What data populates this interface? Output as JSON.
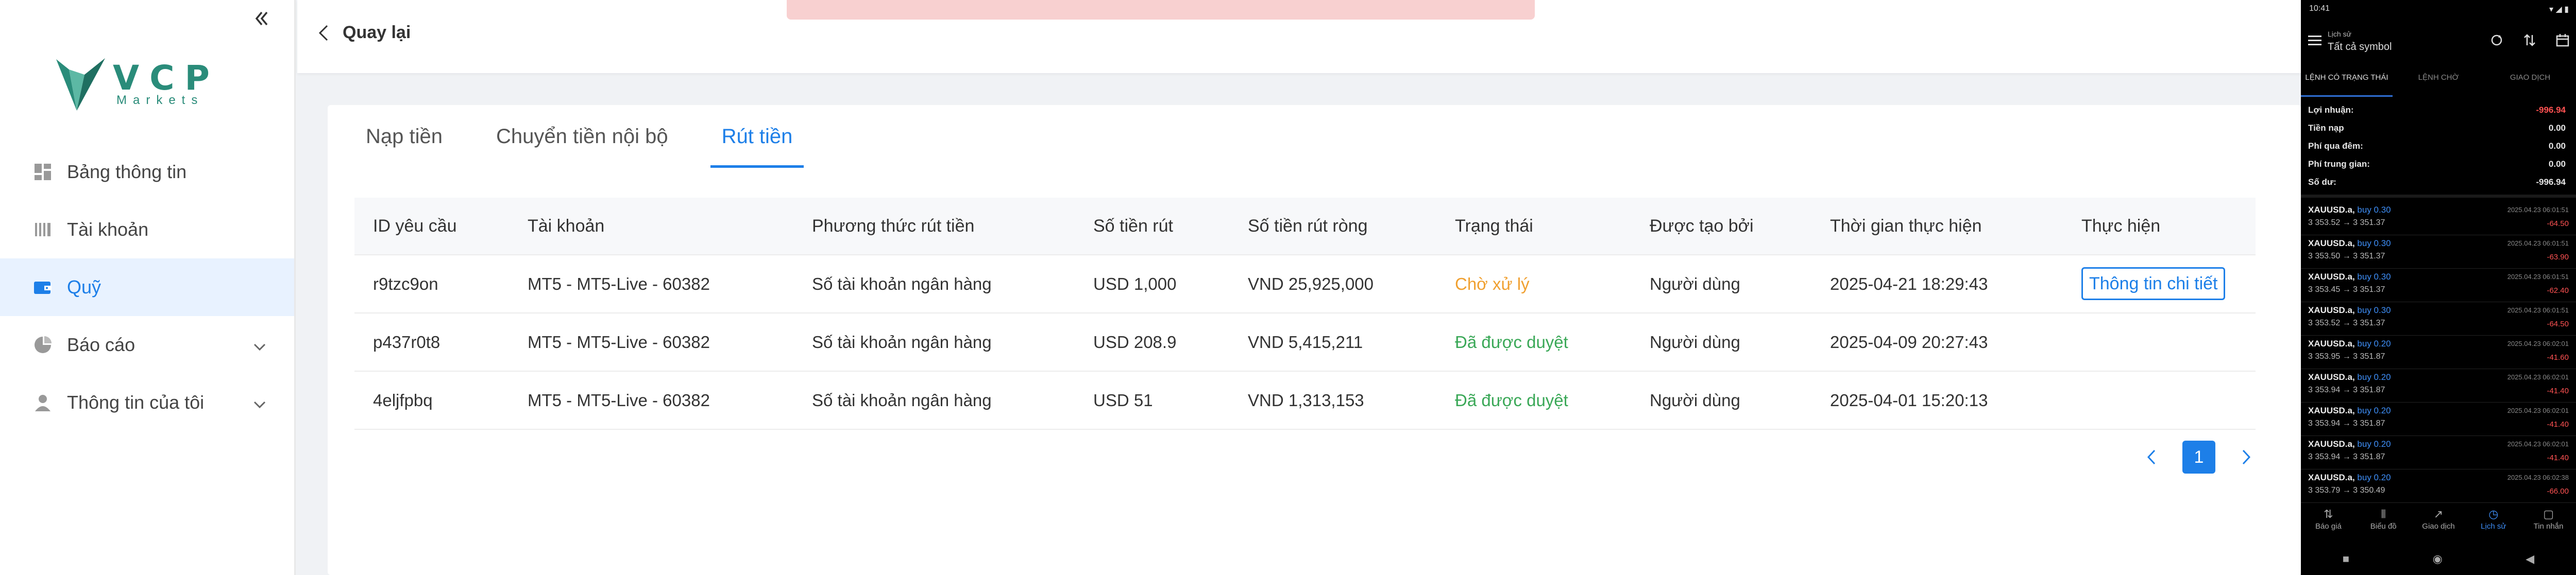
{
  "sidebar": {
    "logo_text": "VCP",
    "logo_sub": "Markets",
    "items": [
      {
        "label": "Bảng thông tin"
      },
      {
        "label": "Tài khoản"
      },
      {
        "label": "Quỹ"
      },
      {
        "label": "Báo cáo"
      },
      {
        "label": "Thông tin của tôi"
      }
    ]
  },
  "header": {
    "back_label": "Quay lại"
  },
  "tabs": [
    {
      "label": "Nạp tiền"
    },
    {
      "label": "Chuyển tiền nội bộ"
    },
    {
      "label": "Rút tiền"
    }
  ],
  "table": {
    "columns": [
      "ID yêu cầu",
      "Tài khoản",
      "Phương thức rút tiền",
      "Số tiền rút",
      "Số tiền rút ròng",
      "Trạng thái",
      "Được tạo bởi",
      "Thời gian thực hiện",
      "Thực hiện"
    ],
    "rows": [
      {
        "id": "r9tzc9on",
        "account": "MT5 - MT5-Live - 60382",
        "method": "Số tài khoản ngân hàng",
        "amount": "USD 1,000",
        "net": "VND 25,925,000",
        "status": "Chờ xử lý",
        "created_by": "Người dùng",
        "time": "2025-04-21 18:29:43",
        "action": "Thông tin chi tiết"
      },
      {
        "id": "p437r0t8",
        "account": "MT5 - MT5-Live - 60382",
        "method": "Số tài khoản ngân hàng",
        "amount": "USD 208.9",
        "net": "VND 5,415,211",
        "status": "Đã được duyệt",
        "created_by": "Người dùng",
        "time": "2025-04-09 20:27:43",
        "action": ""
      },
      {
        "id": "4eljfpbq",
        "account": "MT5 - MT5-Live - 60382",
        "method": "Số tài khoản ngân hàng",
        "amount": "USD 51",
        "net": "VND 1,313,153",
        "status": "Đã được duyệt",
        "created_by": "Người dùng",
        "time": "2025-04-01 15:20:13",
        "action": ""
      }
    ]
  },
  "pagination": {
    "current": "1"
  },
  "colors": {
    "accent": "#1d7fe8",
    "pending": "#f0a030",
    "approved": "#3aa857",
    "brand": "#2a8c7a"
  },
  "phone": {
    "time": "10:41",
    "title_small": "Lịch sử",
    "title": "Tất cả symbol",
    "tabs": [
      "LỆNH CÓ TRẠNG THÁI",
      "LỆNH CHỜ",
      "GIAO DỊCH"
    ],
    "summary": [
      {
        "label": "Lợi nhuận:",
        "value": "-996.94"
      },
      {
        "label": "Tiền nạp",
        "value": "0.00"
      },
      {
        "label": "Phí qua đêm:",
        "value": "0.00"
      },
      {
        "label": "Phí trung gian:",
        "value": "0.00"
      },
      {
        "label": "Số dư:",
        "value": "-996.94"
      }
    ],
    "trades": [
      {
        "symbol": "XAUUSD.a,",
        "side": "buy 0.30",
        "price": "3 353.52 → 3 351.37",
        "time": "2025.04.23 06:01:51",
        "pl": "-64.50"
      },
      {
        "symbol": "XAUUSD.a,",
        "side": "buy 0.30",
        "price": "3 353.50 → 3 351.37",
        "time": "2025.04.23 06:01:51",
        "pl": "-63.90"
      },
      {
        "symbol": "XAUUSD.a,",
        "side": "buy 0.30",
        "price": "3 353.45 → 3 351.37",
        "time": "2025.04.23 06:01:51",
        "pl": "-62.40"
      },
      {
        "symbol": "XAUUSD.a,",
        "side": "buy 0.30",
        "price": "3 353.52 → 3 351.37",
        "time": "2025.04.23 06:01:51",
        "pl": "-64.50"
      },
      {
        "symbol": "XAUUSD.a,",
        "side": "buy 0.20",
        "price": "3 353.95 → 3 351.87",
        "time": "2025.04.23 06:02:01",
        "pl": "-41.60"
      },
      {
        "symbol": "XAUUSD.a,",
        "side": "buy 0.20",
        "price": "3 353.94 → 3 351.87",
        "time": "2025.04.23 06:02:01",
        "pl": "-41.40"
      },
      {
        "symbol": "XAUUSD.a,",
        "side": "buy 0.20",
        "price": "3 353.94 → 3 351.87",
        "time": "2025.04.23 06:02:01",
        "pl": "-41.40"
      },
      {
        "symbol": "XAUUSD.a,",
        "side": "buy 0.20",
        "price": "3 353.94 → 3 351.87",
        "time": "2025.04.23 06:02:01",
        "pl": "-41.40"
      },
      {
        "symbol": "XAUUSD.a,",
        "side": "buy 0.20",
        "price": "3 353.79 → 3 350.49",
        "time": "2025.04.23 06:02:38",
        "pl": "-66.00"
      }
    ],
    "nav": [
      "Báo giá",
      "Biểu đồ",
      "Giao dịch",
      "Lịch sử",
      "Tin nhắn"
    ]
  }
}
